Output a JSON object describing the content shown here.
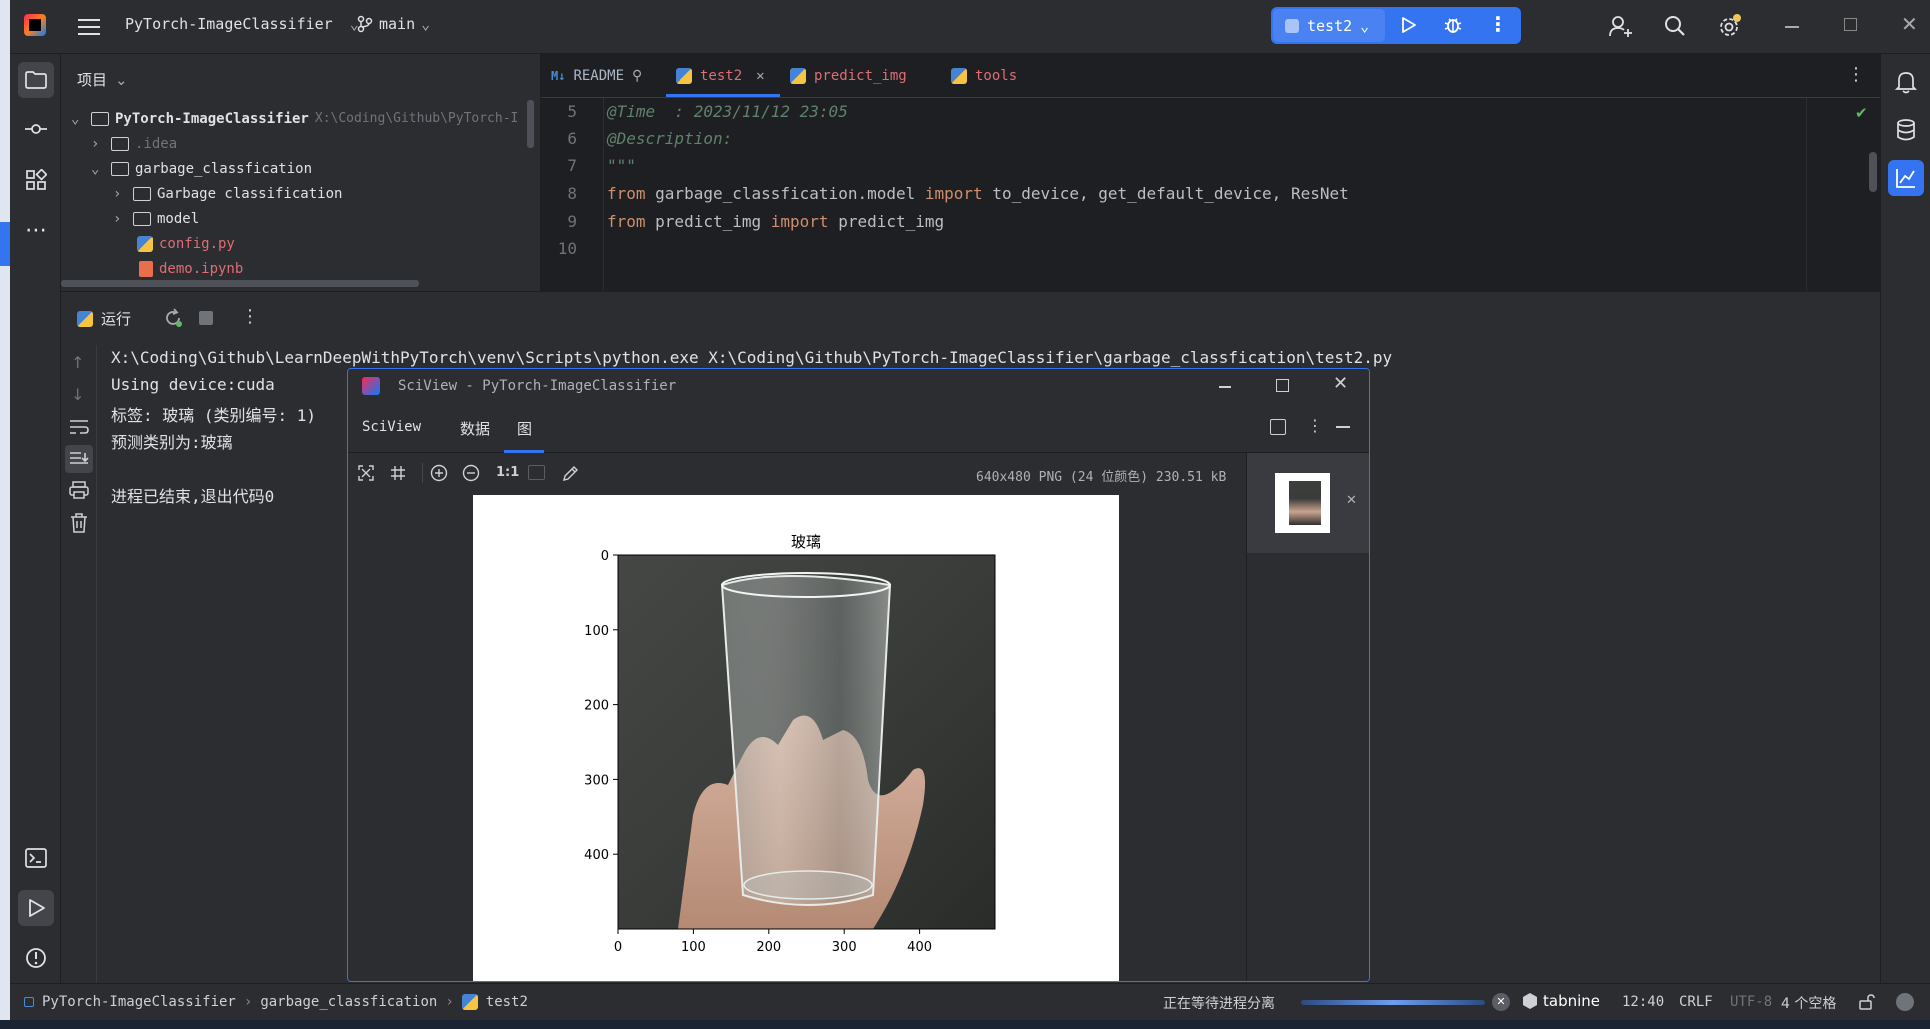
{
  "titlebar": {
    "project": "PyTorch-ImageClassifier",
    "branch": "main",
    "run_config": "test2"
  },
  "project_panel": {
    "title": "项目",
    "tree": [
      {
        "label": "PyTorch-ImageClassifier",
        "path": "X:\\Coding\\Github\\PyTorch-I"
      },
      {
        "label": ".idea"
      },
      {
        "label": "garbage_classfication"
      },
      {
        "label": "Garbage classification"
      },
      {
        "label": "model"
      },
      {
        "label": "config.py"
      },
      {
        "label": "demo.ipynb"
      }
    ]
  },
  "editor": {
    "tabs": [
      {
        "label": "README"
      },
      {
        "label": "test2"
      },
      {
        "label": "predict_img"
      },
      {
        "label": "tools"
      }
    ],
    "lines": [
      {
        "n": "5",
        "text": "@Time  : 2023/11/12 23:05"
      },
      {
        "n": "6",
        "text": "@Description:"
      },
      {
        "n": "7",
        "text": "\"\"\""
      },
      {
        "n": "8",
        "kw1": "from",
        "mod": " garbage_classfication.model ",
        "kw2": "import",
        "rest": " to_device, get_default_device, ResNet"
      },
      {
        "n": "9",
        "kw1": "from",
        "mod": " predict_img ",
        "kw2": "import",
        "rest": " predict_img"
      },
      {
        "n": "10",
        "text": ""
      }
    ]
  },
  "run_panel": {
    "title": "运行",
    "console": [
      "X:\\Coding\\Github\\LearnDeepWithPyTorch\\venv\\Scripts\\python.exe X:\\Coding\\Github\\PyTorch-ImageClassifier\\garbage_classfication\\test2.py",
      "Using device:cuda",
      "标签: 玻璃 (类别编号: 1)",
      "预测类别为:玻璃",
      "",
      "进程已结束,退出代码0"
    ]
  },
  "sciview": {
    "title": "SciView - PyTorch-ImageClassifier",
    "tabs": [
      "SciView",
      "数据",
      "图"
    ],
    "zoom_label": "1:1",
    "image_info": "640x480 PNG (24 位颜色) 230.51 kB"
  },
  "chart_data": {
    "type": "image",
    "title": "玻璃",
    "xticks": [
      "0",
      "100",
      "200",
      "300",
      "400"
    ],
    "yticks": [
      "0",
      "100",
      "200",
      "300",
      "400"
    ],
    "xlim": [
      0,
      500
    ],
    "ylim": [
      500,
      0
    ]
  },
  "statusbar": {
    "breadcrumb": [
      "PyTorch-ImageClassifier",
      "garbage_classfication",
      "test2"
    ],
    "progress_text": "正在等待进程分离",
    "tabnine": "tabnine",
    "position": "12:40",
    "line_sep": "CRLF",
    "encoding": "UTF-8",
    "indent": "4 个空格"
  },
  "colors": {
    "accent": "#3574f0",
    "keyword": "#cf8e6d",
    "docstring": "#5f826b",
    "modified_file": "#e06c75"
  }
}
